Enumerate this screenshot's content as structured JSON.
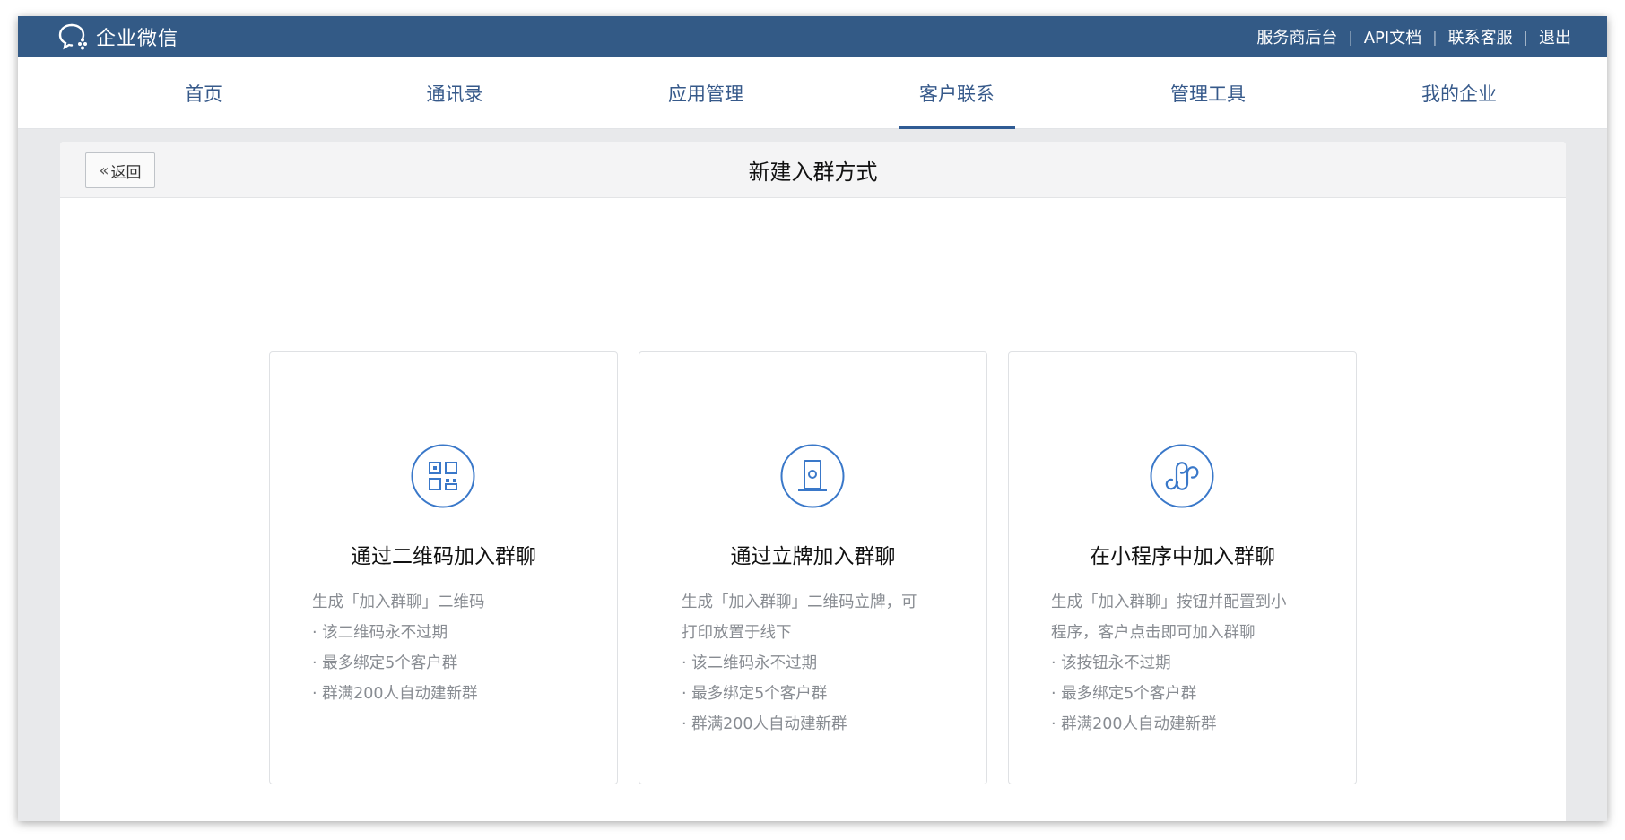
{
  "app": {
    "logo_text": "企业微信"
  },
  "top_links": [
    "服务商后台",
    "API文档",
    "联系客服",
    "退出"
  ],
  "nav": {
    "items": [
      "首页",
      "通讯录",
      "应用管理",
      "客户联系",
      "管理工具",
      "我的企业"
    ],
    "active": "客户联系"
  },
  "page": {
    "back_label": "返回",
    "title": "新建入群方式"
  },
  "colors": {
    "topbar": "#335a86",
    "accent": "#2f5b94",
    "icon": "#3a78c9"
  },
  "cards": [
    {
      "icon": "qrcode-icon",
      "title": "通过二维码加入群聊",
      "desc": [
        "生成「加入群聊」二维码",
        "· 该二维码永不过期",
        "· 最多绑定5个客户群",
        "· 群满200人自动建新群"
      ]
    },
    {
      "icon": "stand-sign-icon",
      "title": "通过立牌加入群聊",
      "desc": [
        "生成「加入群聊」二维码立牌，可",
        "打印放置于线下",
        "· 该二维码永不过期",
        "· 最多绑定5个客户群",
        "· 群满200人自动建新群"
      ]
    },
    {
      "icon": "mini-program-icon",
      "title": "在小程序中加入群聊",
      "desc": [
        "生成「加入群聊」按钮并配置到小",
        "程序，客户点击即可加入群聊",
        "· 该按钮永不过期",
        "· 最多绑定5个客户群",
        "· 群满200人自动建新群"
      ]
    }
  ]
}
